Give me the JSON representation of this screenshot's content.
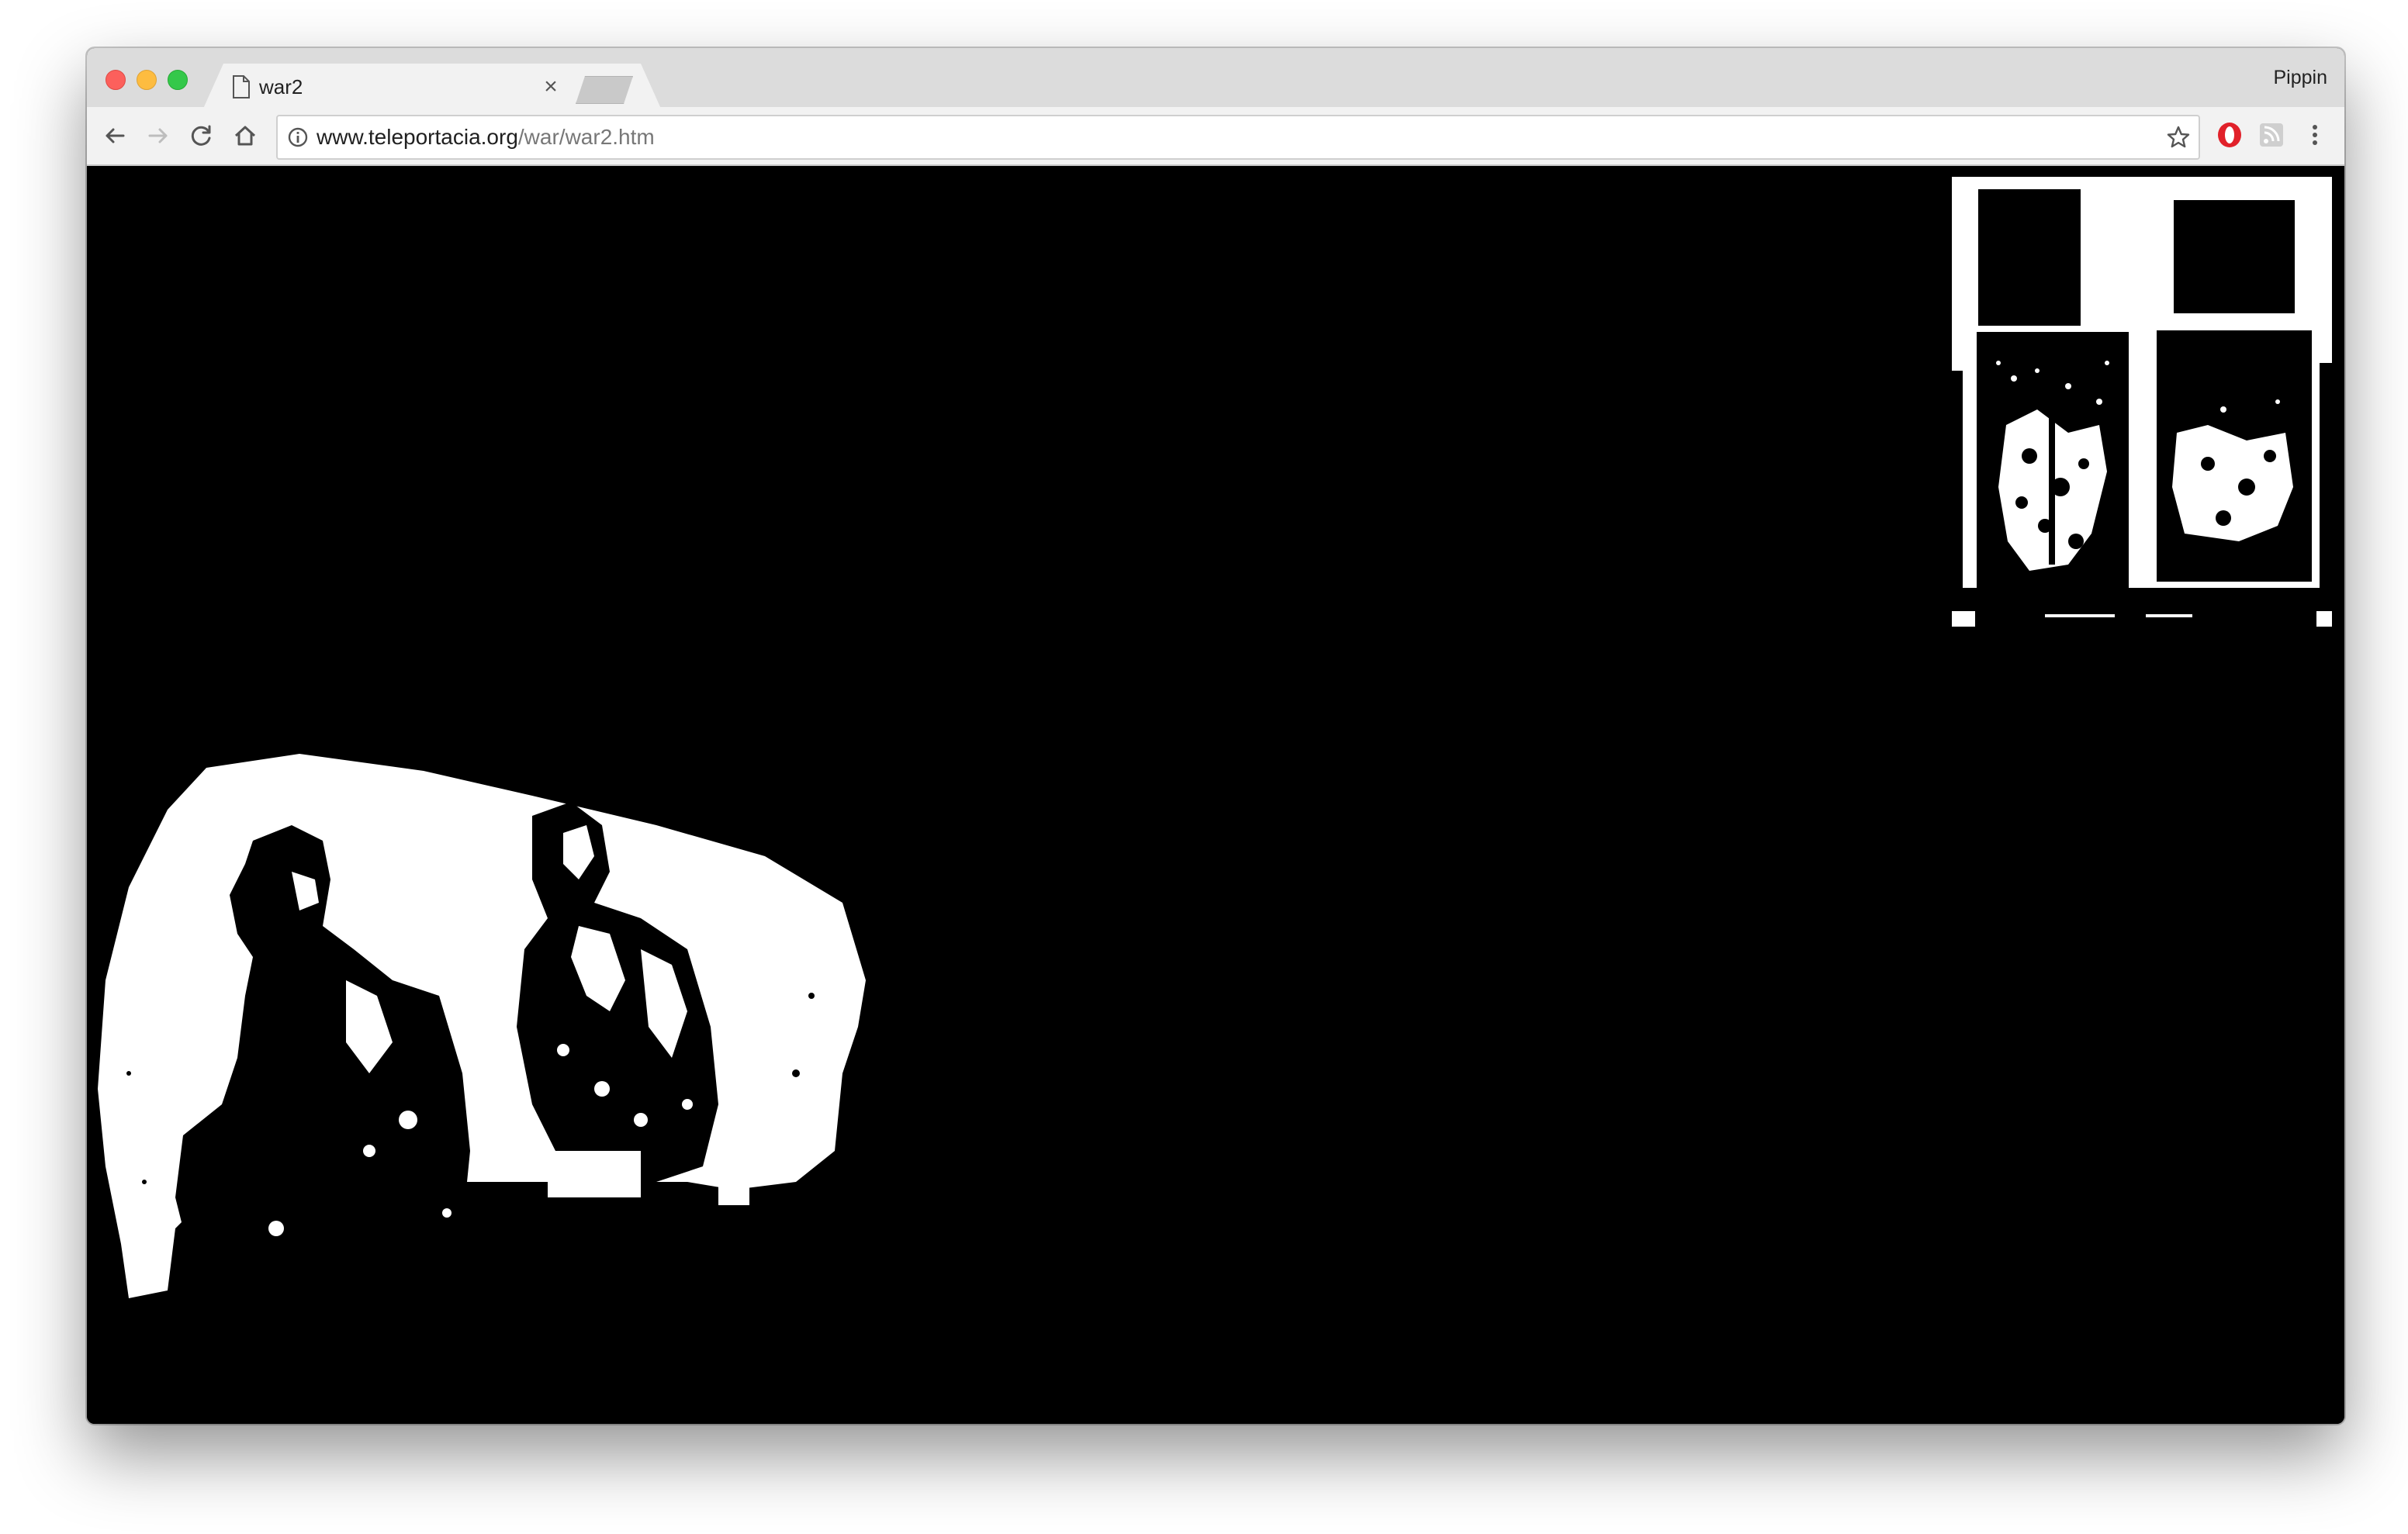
{
  "browser": {
    "tab_title": "war2",
    "tab_close": "×",
    "profile_name": "Pippin",
    "url_domain": "www.teleportacia.org",
    "url_path": "/war/war2.htm",
    "icons": {
      "back": "arrow-left-icon",
      "forward": "arrow-right-icon",
      "reload": "reload-icon",
      "home": "home-icon",
      "info": "info-icon",
      "bookmark": "star-icon",
      "opera": "opera-icon",
      "rss": "rss-icon",
      "menu": "kebab-menu-icon"
    }
  },
  "page": {
    "background": "#000000",
    "images": [
      {
        "name": "window-image",
        "description_icon": "window-photo"
      },
      {
        "name": "sofa-men-image",
        "description_icon": "two-men-on-sofa-photo"
      }
    ]
  },
  "colors": {
    "titlebar": "#dcdcdc",
    "toolbar": "#f2f2f2",
    "close": "#fc605c",
    "minimize": "#fdbc40",
    "maximize": "#34c84a"
  }
}
